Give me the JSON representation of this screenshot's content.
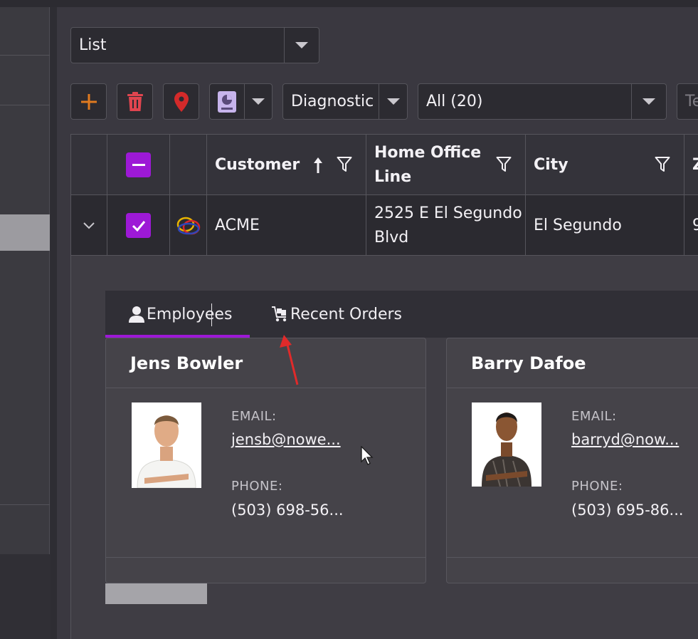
{
  "view_select": {
    "value": "List"
  },
  "toolbar": {
    "add_icon": "plus-icon",
    "delete_icon": "trash-icon",
    "map_icon": "map-pin-icon",
    "report_icon": "report-icon",
    "diagnostic_select": "Diagnostic",
    "filter_select": "All (20)",
    "search_placeholder": "Te"
  },
  "grid": {
    "columns": [
      "Customer",
      "Home Office Line",
      "City",
      "Z"
    ],
    "sort_column": "Customer",
    "sort_direction": "ascending",
    "rows": [
      {
        "customer": "ACME",
        "home_office_line": "2525 E El Segundo Blvd",
        "city": "El Segundo",
        "zip": "9",
        "selected": true,
        "expanded": true
      }
    ]
  },
  "detail": {
    "tabs": [
      {
        "label": "Employees",
        "icon": "person-icon",
        "active": true
      },
      {
        "label": "Recent Orders",
        "icon": "cart-icon",
        "active": false
      }
    ],
    "employees": [
      {
        "name": "Jens Bowler",
        "email_label": "EMAIL:",
        "email": "jensb@nowe...",
        "phone_label": "PHONE:",
        "phone": "(503) 698-56..."
      },
      {
        "name": "Barry Dafoe",
        "email_label": "EMAIL:",
        "email": "barryd@now...",
        "phone_label": "PHONE:",
        "phone": "(503) 695-86..."
      }
    ]
  },
  "colors": {
    "accent": "#9d19d6",
    "add": "#e07a1f",
    "delete": "#e0454f",
    "map": "#d42a2a",
    "report": "#c7b4ec"
  }
}
